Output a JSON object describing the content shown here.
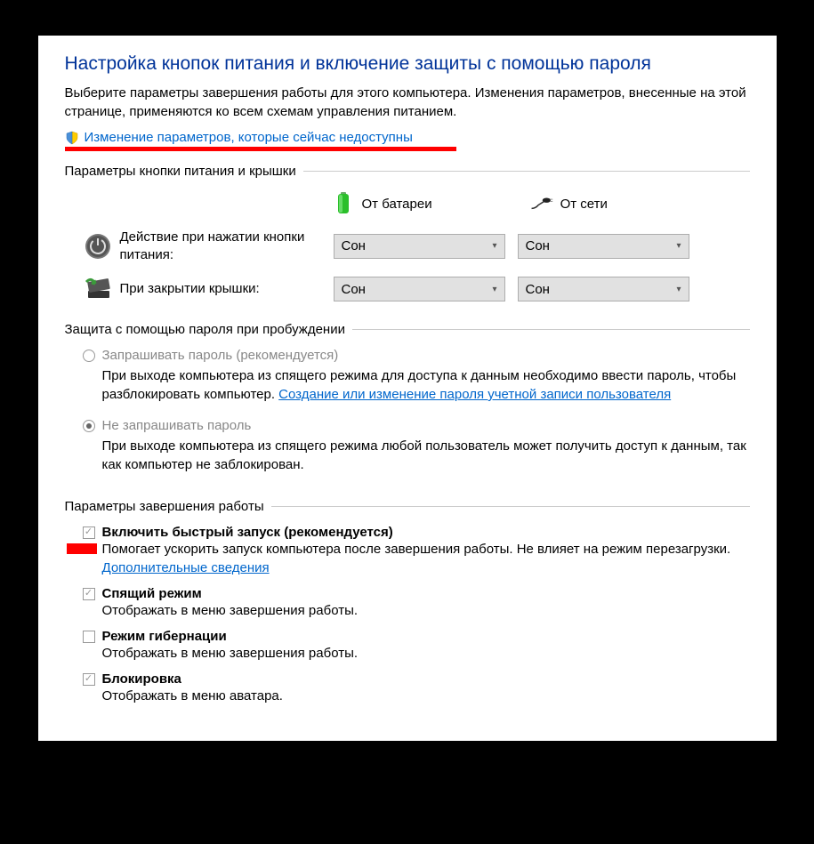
{
  "title": "Настройка кнопок питания и включение защиты с помощью пароля",
  "subtitle": "Выберите параметры завершения работы для этого компьютера. Изменения параметров, внесенные на этой странице, применяются ко всем схемам управления питанием.",
  "change_link": "Изменение параметров, которые сейчас недоступны",
  "section1": {
    "header": "Параметры кнопки питания и крышки",
    "col_battery": "От батареи",
    "col_plugged": "От сети",
    "row_power": {
      "label": "Действие при нажатии кнопки питания:",
      "battery_value": "Сон",
      "plugged_value": "Сон"
    },
    "row_lid": {
      "label": "При закрытии крышки:",
      "battery_value": "Сон",
      "plugged_value": "Сон"
    }
  },
  "section2": {
    "header": "Защита с помощью пароля при пробуждении",
    "opt_require": {
      "label": "Запрашивать пароль (рекомендуется)",
      "desc_part1": "При выходе компьютера из спящего режима для доступа к данным необходимо ввести пароль, чтобы разблокировать компьютер. ",
      "link": "Создание или изменение пароля учетной записи пользователя"
    },
    "opt_norequire": {
      "label": "Не запрашивать пароль",
      "desc": "При выходе компьютера из спящего режима любой пользователь может получить доступ к данным, так как компьютер не заблокирован."
    }
  },
  "section3": {
    "header": "Параметры завершения работы",
    "fast": {
      "title": "Включить быстрый запуск (рекомендуется)",
      "desc_part1": "Помогает ускорить запуск компьютера после завершения работы. Не влияет на режим перезагрузки. ",
      "link": "Дополнительные сведения"
    },
    "sleep": {
      "title": "Спящий режим",
      "desc": "Отображать в меню завершения работы."
    },
    "hibernate": {
      "title": "Режим гибернации",
      "desc": "Отображать в меню завершения работы."
    },
    "lock": {
      "title": "Блокировка",
      "desc": "Отображать в меню аватара."
    }
  }
}
